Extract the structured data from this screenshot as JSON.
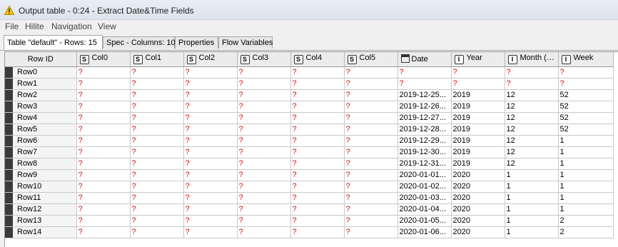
{
  "window": {
    "title": "Output table - 0:24 - Extract Date&Time Fields"
  },
  "menu": [
    "File",
    "Hilite",
    "Navigation",
    "View"
  ],
  "tabs": [
    {
      "label": "Table \"default\" - Rows: 15",
      "active": true
    },
    {
      "label": "Spec - Columns: 10",
      "active": false
    },
    {
      "label": "Properties",
      "active": false
    },
    {
      "label": "Flow Variables",
      "active": false
    }
  ],
  "columns": [
    {
      "label": "Row ID",
      "type": ""
    },
    {
      "label": "Col0",
      "type": "S"
    },
    {
      "label": "Col1",
      "type": "S"
    },
    {
      "label": "Col2",
      "type": "S"
    },
    {
      "label": "Col3",
      "type": "S"
    },
    {
      "label": "Col4",
      "type": "S"
    },
    {
      "label": "Col5",
      "type": "S"
    },
    {
      "label": "Date",
      "type": "date"
    },
    {
      "label": "Year",
      "type": "I"
    },
    {
      "label": "Month (…",
      "type": "I"
    },
    {
      "label": "Week",
      "type": "I"
    }
  ],
  "rows": [
    {
      "id": "Row0",
      "cells": [
        "?",
        "?",
        "?",
        "?",
        "?",
        "?",
        "?",
        "?",
        "?",
        "?"
      ]
    },
    {
      "id": "Row1",
      "cells": [
        "?",
        "?",
        "?",
        "?",
        "?",
        "?",
        "?",
        "?",
        "?",
        "?"
      ]
    },
    {
      "id": "Row2",
      "cells": [
        "?",
        "?",
        "?",
        "?",
        "?",
        "?",
        "2019-12-25...",
        "2019",
        "12",
        "52"
      ]
    },
    {
      "id": "Row3",
      "cells": [
        "?",
        "?",
        "?",
        "?",
        "?",
        "?",
        "2019-12-26...",
        "2019",
        "12",
        "52"
      ]
    },
    {
      "id": "Row4",
      "cells": [
        "?",
        "?",
        "?",
        "?",
        "?",
        "?",
        "2019-12-27...",
        "2019",
        "12",
        "52"
      ]
    },
    {
      "id": "Row5",
      "cells": [
        "?",
        "?",
        "?",
        "?",
        "?",
        "?",
        "2019-12-28...",
        "2019",
        "12",
        "52"
      ]
    },
    {
      "id": "Row6",
      "cells": [
        "?",
        "?",
        "?",
        "?",
        "?",
        "?",
        "2019-12-29...",
        "2019",
        "12",
        "1"
      ]
    },
    {
      "id": "Row7",
      "cells": [
        "?",
        "?",
        "?",
        "?",
        "?",
        "?",
        "2019-12-30...",
        "2019",
        "12",
        "1"
      ]
    },
    {
      "id": "Row8",
      "cells": [
        "?",
        "?",
        "?",
        "?",
        "?",
        "?",
        "2019-12-31...",
        "2019",
        "12",
        "1"
      ]
    },
    {
      "id": "Row9",
      "cells": [
        "?",
        "?",
        "?",
        "?",
        "?",
        "?",
        "2020-01-01...",
        "2020",
        "1",
        "1"
      ]
    },
    {
      "id": "Row10",
      "cells": [
        "?",
        "?",
        "?",
        "?",
        "?",
        "?",
        "2020-01-02...",
        "2020",
        "1",
        "1"
      ]
    },
    {
      "id": "Row11",
      "cells": [
        "?",
        "?",
        "?",
        "?",
        "?",
        "?",
        "2020-01-03...",
        "2020",
        "1",
        "1"
      ]
    },
    {
      "id": "Row12",
      "cells": [
        "?",
        "?",
        "?",
        "?",
        "?",
        "?",
        "2020-01-04...",
        "2020",
        "1",
        "1"
      ]
    },
    {
      "id": "Row13",
      "cells": [
        "?",
        "?",
        "?",
        "?",
        "?",
        "?",
        "2020-01-05...",
        "2020",
        "1",
        "2"
      ]
    },
    {
      "id": "Row14",
      "cells": [
        "?",
        "?",
        "?",
        "?",
        "?",
        "?",
        "2020-01-06...",
        "2020",
        "1",
        "2"
      ]
    }
  ],
  "colors": {
    "missing": "#d11111",
    "rowMarker": "#3b3b3b"
  }
}
